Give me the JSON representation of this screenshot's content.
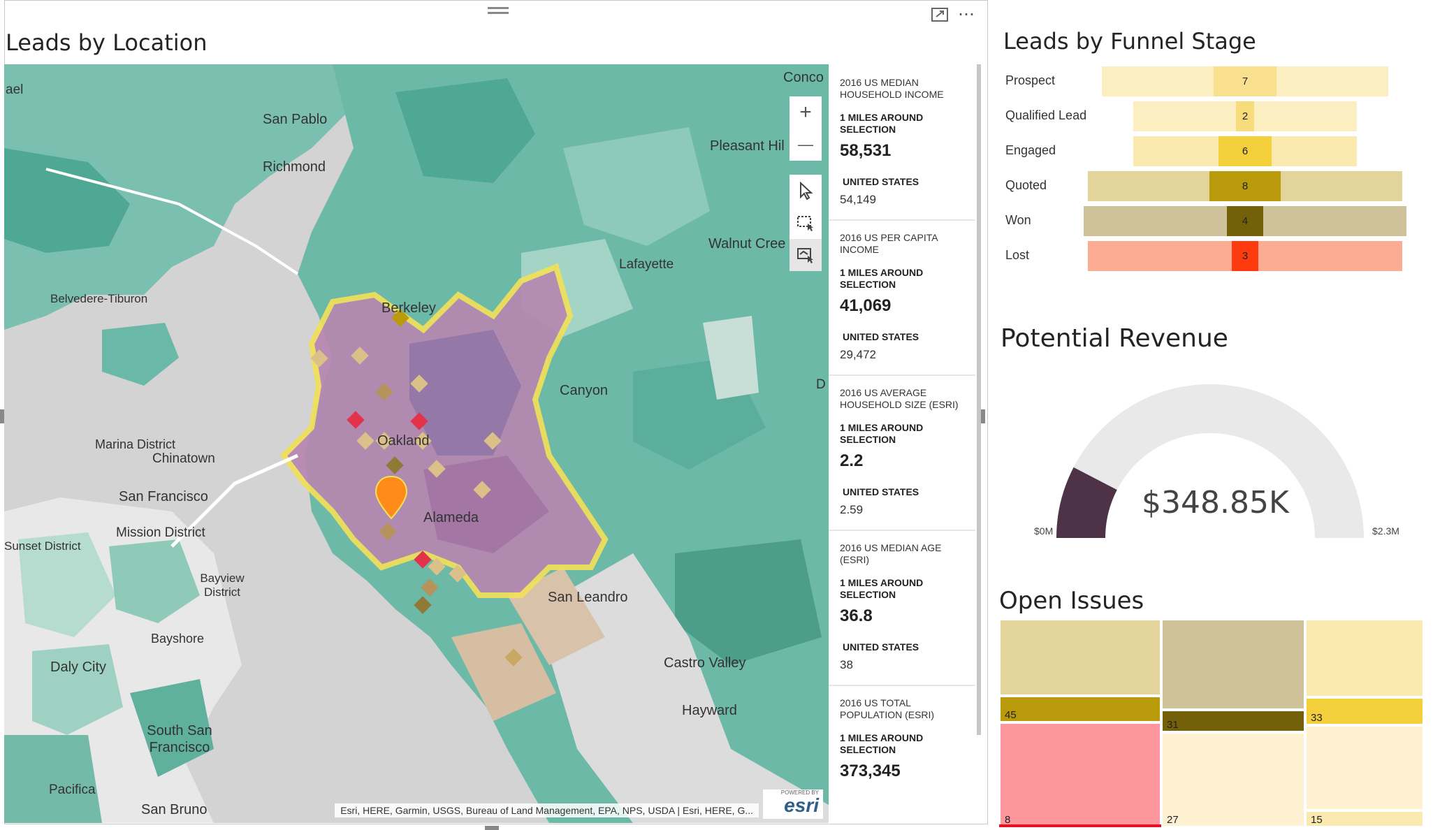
{
  "map_panel": {
    "title": "Leads by Location",
    "place_labels": [
      {
        "name": "Concord",
        "text": "Conco"
      },
      {
        "name": "San Pablo",
        "text": "San Pablo"
      },
      {
        "name": "Richmond",
        "text": "Richmond"
      },
      {
        "name": "Pleasant Hill",
        "text": "Pleasant Hil"
      },
      {
        "name": "Walnut Creek",
        "text": "Walnut Cree"
      },
      {
        "name": "Lafayette",
        "text": "Lafayette"
      },
      {
        "name": "Belvedere-Tiburon",
        "text": "Belvedere-Tiburon"
      },
      {
        "name": "Berkeley",
        "text": "Berkeley"
      },
      {
        "name": "Canyon",
        "text": "Canyon"
      },
      {
        "name": "Marina District",
        "text": "Marina District"
      },
      {
        "name": "Chinatown",
        "text": "Chinatown"
      },
      {
        "name": "San Francisco",
        "text": "San Francisco"
      },
      {
        "name": "Oakland",
        "text": "Oakland"
      },
      {
        "name": "Mission District",
        "text": "Mission District"
      },
      {
        "name": "Sunset District",
        "text": "Sunset District"
      },
      {
        "name": "Alameda",
        "text": "Alameda"
      },
      {
        "name": "Bayview District",
        "text": "Bayview District"
      },
      {
        "name": "San Leandro",
        "text": "San Leandro"
      },
      {
        "name": "Bayshore",
        "text": "Bayshore"
      },
      {
        "name": "Daly City",
        "text": "Daly City"
      },
      {
        "name": "Castro Valley",
        "text": "Castro Valley"
      },
      {
        "name": "Hayward",
        "text": "Hayward"
      },
      {
        "name": "South San Francisco",
        "text": "South San Francisco"
      },
      {
        "name": "Pacifica",
        "text": "Pacifica"
      },
      {
        "name": "San Bruno",
        "text": "San Bruno"
      },
      {
        "name": "ael",
        "text": "ael"
      },
      {
        "name": "D",
        "text": "D"
      }
    ],
    "controls": {
      "zoom_in": "+",
      "zoom_out": "—",
      "select_icon": "pointer-icon",
      "rect_select_icon": "rectangle-select-icon",
      "lasso_select_icon": "reference-layer-select-icon"
    },
    "attribution": "Esri, HERE, Garmin, USGS, Bureau of Land Management, EPA, NPS, USDA | Esri, HERE, G...",
    "esri_logo": {
      "powered_by": "POWERED BY",
      "brand": "esri"
    },
    "header_icons": [
      "focus-mode-icon",
      "more-options-icon"
    ],
    "stats": [
      {
        "title": "2016 US MEDIAN HOUSEHOLD INCOME",
        "around": "1 MILES AROUND SELECTION",
        "value": "58,531",
        "us_label": "UNITED STATES",
        "us_value": "54,149"
      },
      {
        "title": "2016 US PER CAPITA INCOME",
        "around": "1 MILES AROUND SELECTION",
        "value": "41,069",
        "us_label": "UNITED STATES",
        "us_value": "29,472"
      },
      {
        "title": "2016 US AVERAGE HOUSEHOLD SIZE (ESRI)",
        "around": "1 MILES AROUND SELECTION",
        "value": "2.2",
        "us_label": "UNITED STATES",
        "us_value": "2.59"
      },
      {
        "title": "2016 US MEDIAN AGE (ESRI)",
        "around": "1 MILES AROUND SELECTION",
        "value": "36.8",
        "us_label": "UNITED STATES",
        "us_value": "38"
      },
      {
        "title": "2016 US TOTAL POPULATION (ESRI)",
        "around": "1 MILES AROUND SELECTION",
        "value": "373,345",
        "us_label": "",
        "us_value": ""
      }
    ]
  },
  "funnel": {
    "title": "Leads by Funnel Stage",
    "stages": [
      {
        "label": "Prospect",
        "value": "7",
        "bg": "#fbeec1",
        "core": "#f9e08e"
      },
      {
        "label": "Qualified Lead",
        "value": "2",
        "bg": "#fbeec1",
        "core": "#f6dc7a"
      },
      {
        "label": "Engaged",
        "value": "6",
        "bg": "#faeab0",
        "core": "#f2cf3b"
      },
      {
        "label": "Quoted",
        "value": "8",
        "bg": "#e3d49b",
        "core": "#b99a0b"
      },
      {
        "label": "Won",
        "value": "4",
        "bg": "#cfc29b",
        "core": "#736009"
      },
      {
        "label": "Lost",
        "value": "3",
        "bg": "#fdac94",
        "core": "#fe3b0e"
      }
    ]
  },
  "gauge": {
    "title": "Potential Revenue",
    "value_label": "$348.85K",
    "min_label": "$0M",
    "max_label": "$2.3M",
    "fraction": 0.152,
    "fill_color": "#4d3248",
    "track_color": "#e9e9e9"
  },
  "issues": {
    "title": "Open Issues",
    "cells": [
      {
        "label": "",
        "color": "#e3d49b"
      },
      {
        "label": "45",
        "color": "#b99a0b"
      },
      {
        "label": "8",
        "color": "#fe969e"
      },
      {
        "label": "",
        "color": "#cfc29b"
      },
      {
        "label": "31",
        "color": "#736009"
      },
      {
        "label": "27",
        "color": "#fdf1d2"
      },
      {
        "label": "",
        "color": "#faeab0"
      },
      {
        "label": "33",
        "color": "#f2cf3b"
      },
      {
        "label": "",
        "color": "#fdf1d2"
      },
      {
        "label": "15",
        "color": "#faeab0"
      }
    ]
  }
}
